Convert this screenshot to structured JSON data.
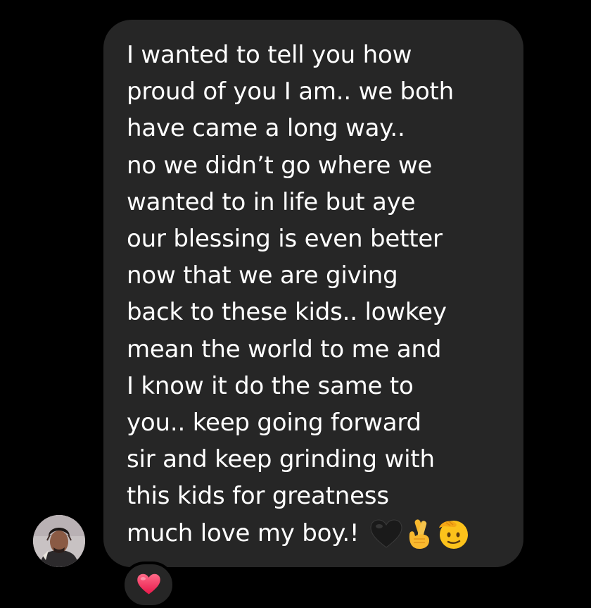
{
  "message": {
    "lines": [
      "I wanted to tell you how",
      "proud of you I am.. we both",
      "have came a long way..",
      "no we didn’t go where we",
      "wanted to in life but aye",
      "our blessing is even better",
      "now that we are giving",
      "back to these kids.. lowkey",
      "mean the world to me and",
      "I know it do the same to",
      "you.. keep going forward",
      "sir and keep grinding with",
      "this kids for greatness",
      "much love my boy.!"
    ],
    "trailing_emojis": [
      "black-heart",
      "crossed-fingers",
      "saluting-face"
    ],
    "bubble_color": "#262626",
    "text_color": "#ffffff"
  },
  "sender": {
    "avatar": "profile-photo"
  },
  "reaction": {
    "emoji": "red-heart",
    "color": "#f2335f"
  },
  "background_color": "#000000"
}
